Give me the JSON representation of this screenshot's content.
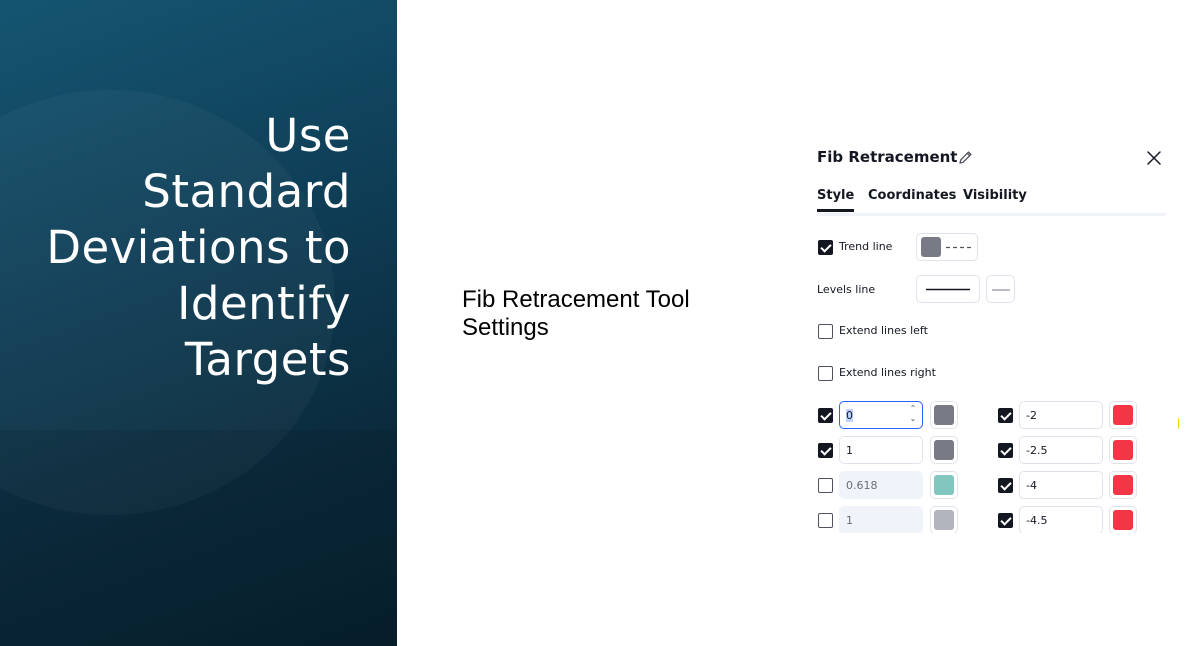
{
  "slide": {
    "title_lines": [
      "Use",
      "Standard",
      "Deviations to",
      "Identify",
      "Targets"
    ],
    "caption": "Fib Retracement Tool Settings"
  },
  "dialog": {
    "title": "Fib Retracement",
    "tabs": [
      {
        "label": "Style",
        "active": true
      },
      {
        "label": "Coordinates",
        "active": false
      },
      {
        "label": "Visibility",
        "active": false
      }
    ],
    "options": {
      "trend_line": {
        "label": "Trend line",
        "checked": true,
        "color": "#787b86"
      },
      "levels_line": {
        "label": "Levels line"
      },
      "extend_left": {
        "label": "Extend lines left",
        "checked": false
      },
      "extend_right": {
        "label": "Extend lines right",
        "checked": false
      }
    },
    "levels_left": [
      {
        "value": "0",
        "checked": true,
        "color": "#787b86",
        "focused": true
      },
      {
        "value": "1",
        "checked": true,
        "color": "#787b86"
      },
      {
        "value": "0.618",
        "checked": false,
        "color": "#81c7c0"
      },
      {
        "value": "1",
        "checked": false,
        "color": "#b2b5be"
      }
    ],
    "levels_right": [
      {
        "value": "-2",
        "checked": true,
        "color": "#f23645"
      },
      {
        "value": "-2.5",
        "checked": true,
        "color": "#f23645"
      },
      {
        "value": "-4",
        "checked": true,
        "color": "#f23645"
      },
      {
        "value": "-4.5",
        "checked": true,
        "color": "#f23645"
      }
    ]
  }
}
